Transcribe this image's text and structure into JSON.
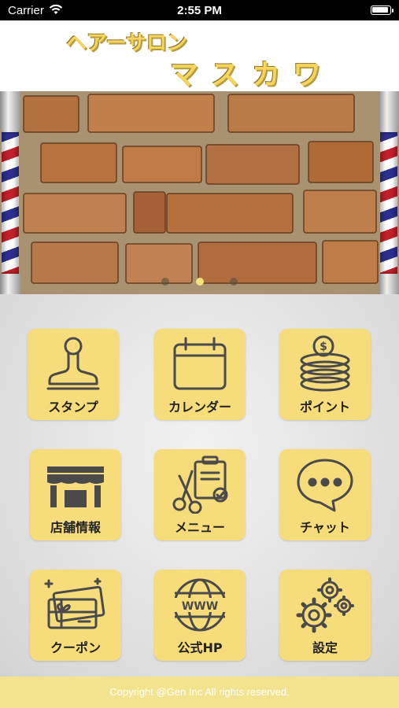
{
  "status_bar": {
    "carrier": "Carrier",
    "time": "2:55 PM",
    "wifi_icon": "wifi-icon",
    "battery_icon": "battery-icon"
  },
  "header": {
    "logo_line1": "ヘアーサロン",
    "logo_line2": "マスカワ",
    "logo_color": "#f6d55c"
  },
  "banner": {
    "description_icon": "barber-pole-icon",
    "page_count": 3,
    "active_page": 2
  },
  "menu": {
    "tile_color": "#f7dc7c",
    "items": [
      {
        "label": "スタンプ",
        "icon": "stamp-icon"
      },
      {
        "label": "カレンダー",
        "icon": "calendar-icon"
      },
      {
        "label": "ポイント",
        "icon": "coins-icon"
      },
      {
        "label": "店舗情報",
        "icon": "store-icon"
      },
      {
        "label": "メニュー",
        "icon": "scissors-clipboard-icon"
      },
      {
        "label": "チャット",
        "icon": "chat-bubble-icon"
      },
      {
        "label": "クーポン",
        "icon": "coupon-icon"
      },
      {
        "label": "公式HP",
        "icon": "globe-www-icon"
      },
      {
        "label": "設定",
        "icon": "gears-icon"
      }
    ]
  },
  "footer": {
    "copyright": "Copyright @Gen Inc All rights reserved.",
    "background_color": "#f3e38e"
  }
}
